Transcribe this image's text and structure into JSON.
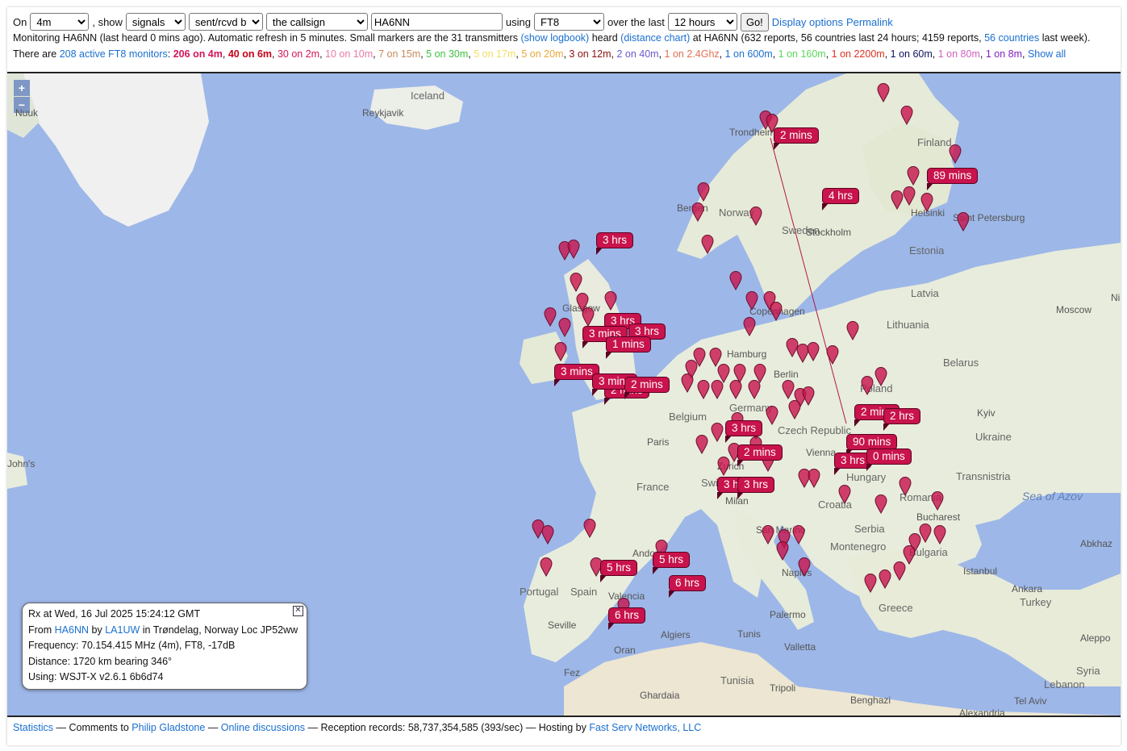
{
  "controls": {
    "on_label": "On",
    "band_value": "4m",
    "show_label": ", show",
    "show_value": "signals",
    "direction_value": "sent/rcvd by",
    "target_value": "the callsign",
    "callsign_value": "HA6NN",
    "using_label": "using",
    "mode_value": "FT8",
    "over_label": "over the last",
    "period_value": "12 hours",
    "go_label": "Go!",
    "display_options": "Display options",
    "permalink": "Permalink"
  },
  "status": {
    "part1": "Monitoring HA6NN (last heard 0 mins ago). Automatic refresh in 5 minutes. Small markers are the 31 transmitters",
    "show_logbook": "(show logbook)",
    "heard": "heard",
    "distance_chart": "(distance chart)",
    "part2": "at HA6NN (632 reports, 56 countries last 24 hours; 4159 reports,",
    "countries_link": "56 countries",
    "part3": "last week)."
  },
  "monitors": {
    "prefix": "There are",
    "active_link": "208 active FT8 monitors",
    "bands": [
      {
        "label": "206 on 4m",
        "color": "#d4145a",
        "bold": true
      },
      {
        "label": "40 on 6m",
        "color": "#c40018",
        "bold": true
      },
      {
        "label": "30 on 2m",
        "color": "#d4145a",
        "bold": false
      },
      {
        "label": "10 on 10m",
        "color": "#e87aa8",
        "bold": false
      },
      {
        "label": "7 on 15m",
        "color": "#c88a5a",
        "bold": false
      },
      {
        "label": "5 on 30m",
        "color": "#3fbf3f",
        "bold": false
      },
      {
        "label": "5 on 17m",
        "color": "#f0e060",
        "bold": false
      },
      {
        "label": "5 on 20m",
        "color": "#e8a838",
        "bold": false
      },
      {
        "label": "3 on 12m",
        "color": "#8a1010",
        "bold": false
      },
      {
        "label": "2 on 40m",
        "color": "#6a5acd",
        "bold": false
      },
      {
        "label": "1 on 2.4Ghz",
        "color": "#e07050",
        "bold": false
      },
      {
        "label": "1 on 600m",
        "color": "#1a6fcf",
        "bold": false
      },
      {
        "label": "1 on 160m",
        "color": "#58d858",
        "bold": false
      },
      {
        "label": "1 on 2200m",
        "color": "#e03020",
        "bold": false
      },
      {
        "label": "1 on 60m",
        "color": "#101060",
        "bold": false
      },
      {
        "label": "1 on 80m",
        "color": "#d060c0",
        "bold": false
      },
      {
        "label": "1 on 8m",
        "color": "#8020c0",
        "bold": false
      }
    ],
    "show_all": "Show all"
  },
  "map": {
    "zoom_in": "+",
    "zoom_out": "−",
    "places": [
      {
        "text": "Iceland",
        "cls": "country"
      },
      {
        "text": "Reykjavik",
        "cls": ""
      },
      {
        "text": "Nuuk",
        "cls": ""
      },
      {
        "text": "Trondheim",
        "cls": ""
      },
      {
        "text": "Finland",
        "cls": "country"
      },
      {
        "text": "Helsinki",
        "cls": ""
      },
      {
        "text": "Saint Petersburg",
        "cls": ""
      },
      {
        "text": "Bergen",
        "cls": ""
      },
      {
        "text": "Norway",
        "cls": "country"
      },
      {
        "text": "Sweden",
        "cls": "country"
      },
      {
        "text": "Stockholm",
        "cls": ""
      },
      {
        "text": "Estonia",
        "cls": "country"
      },
      {
        "text": "Latvia",
        "cls": "country"
      },
      {
        "text": "Lithuania",
        "cls": "country"
      },
      {
        "text": "Moscow",
        "cls": ""
      },
      {
        "text": "Glasgow",
        "cls": ""
      },
      {
        "text": "Copenhagen",
        "cls": ""
      },
      {
        "text": "Hamburg",
        "cls": ""
      },
      {
        "text": "Berlin",
        "cls": ""
      },
      {
        "text": "Belarus",
        "cls": "country"
      },
      {
        "text": "Poland",
        "cls": "country"
      },
      {
        "text": "Belgium",
        "cls": "country"
      },
      {
        "text": "Germany",
        "cls": "country"
      },
      {
        "text": "Czech Republic",
        "cls": "country"
      },
      {
        "text": "Kyiv",
        "cls": ""
      },
      {
        "text": "Ukraine",
        "cls": "country"
      },
      {
        "text": "Paris",
        "cls": ""
      },
      {
        "text": "Vienna",
        "cls": ""
      },
      {
        "text": "France",
        "cls": "country"
      },
      {
        "text": "Zurich",
        "cls": ""
      },
      {
        "text": "Switzerland",
        "cls": "country"
      },
      {
        "text": "Hungary",
        "cls": "country"
      },
      {
        "text": "Transnistria",
        "cls": "country"
      },
      {
        "text": "Sea of Azov",
        "cls": "sea"
      },
      {
        "text": "Milan",
        "cls": ""
      },
      {
        "text": "Croatia",
        "cls": "country"
      },
      {
        "text": "Romania",
        "cls": "country"
      },
      {
        "text": "Bucharest",
        "cls": ""
      },
      {
        "text": "San Marino",
        "cls": ""
      },
      {
        "text": "Serbia",
        "cls": "country"
      },
      {
        "text": "Montenegro",
        "cls": "country"
      },
      {
        "text": "Bulgaria",
        "cls": "country"
      },
      {
        "text": "Andorra",
        "cls": ""
      },
      {
        "text": "Portugal",
        "cls": "country"
      },
      {
        "text": "Spain",
        "cls": "country"
      },
      {
        "text": "Valencia",
        "cls": ""
      },
      {
        "text": "Naples",
        "cls": ""
      },
      {
        "text": "Istanbul",
        "cls": ""
      },
      {
        "text": "Ankara",
        "cls": ""
      },
      {
        "text": "Turkey",
        "cls": "country"
      },
      {
        "text": "Greece",
        "cls": "country"
      },
      {
        "text": "Palermo",
        "cls": ""
      },
      {
        "text": "Seville",
        "cls": ""
      },
      {
        "text": "Algiers",
        "cls": ""
      },
      {
        "text": "Tunis",
        "cls": ""
      },
      {
        "text": "Oran",
        "cls": ""
      },
      {
        "text": "Valletta",
        "cls": ""
      },
      {
        "text": "Fez",
        "cls": ""
      },
      {
        "text": "Tunisia",
        "cls": "country"
      },
      {
        "text": "Tripoli",
        "cls": ""
      },
      {
        "text": "Aleppo",
        "cls": ""
      },
      {
        "text": "Syria",
        "cls": "country"
      },
      {
        "text": "Lebanon",
        "cls": "country"
      },
      {
        "text": "Tel Aviv",
        "cls": ""
      },
      {
        "text": "Ghardaia",
        "cls": ""
      },
      {
        "text": "Benghazi",
        "cls": ""
      },
      {
        "text": "Alexandria",
        "cls": ""
      },
      {
        "text": "John's",
        "cls": ""
      },
      {
        "text": "Abkhaz",
        "cls": ""
      },
      {
        "text": "Niz",
        "cls": ""
      }
    ],
    "tags": [
      "2 mins",
      "89 mins",
      "4 hrs",
      "3 hrs",
      "3 hrs",
      "3 mins",
      "3 hrs",
      "1 mins",
      "3 mins",
      "2 mins",
      "3 mins",
      "2 mins",
      "3 hrs",
      "3 hrs",
      "2 mins",
      "2 mins",
      "2 hrs",
      "90 mins",
      "3 hrs",
      "0 mins",
      "3 hrs",
      "5 hrs",
      "5 hrs",
      "6 hrs",
      "6 hrs"
    ]
  },
  "info": {
    "line1": "Rx at Wed, 16 Jul 2025 15:24:12 GMT",
    "from_label": "From",
    "from_call": "HA6NN",
    "by_label": "by",
    "by_call": "LA1UW",
    "location": "in Trøndelag, Norway Loc JP52ww",
    "frequency": "Frequency: 70.154.415 MHz (4m), FT8, -17dB",
    "distance": "Distance: 1720 km bearing 346°",
    "using": "Using: WSJT-X v2.6.1 6b6d74"
  },
  "footer": {
    "statistics": "Statistics",
    "comments": "— Comments to",
    "author": "Philip Gladstone",
    "dash": "—",
    "discussions": "Online discussions",
    "records": "— Reception records: 58,737,354,585 (393/sec) — Hosting by",
    "hosting": "Fast Serv Networks, LLC"
  },
  "colors": {
    "marker": "#c8134c",
    "link": "#1a6fcf"
  }
}
